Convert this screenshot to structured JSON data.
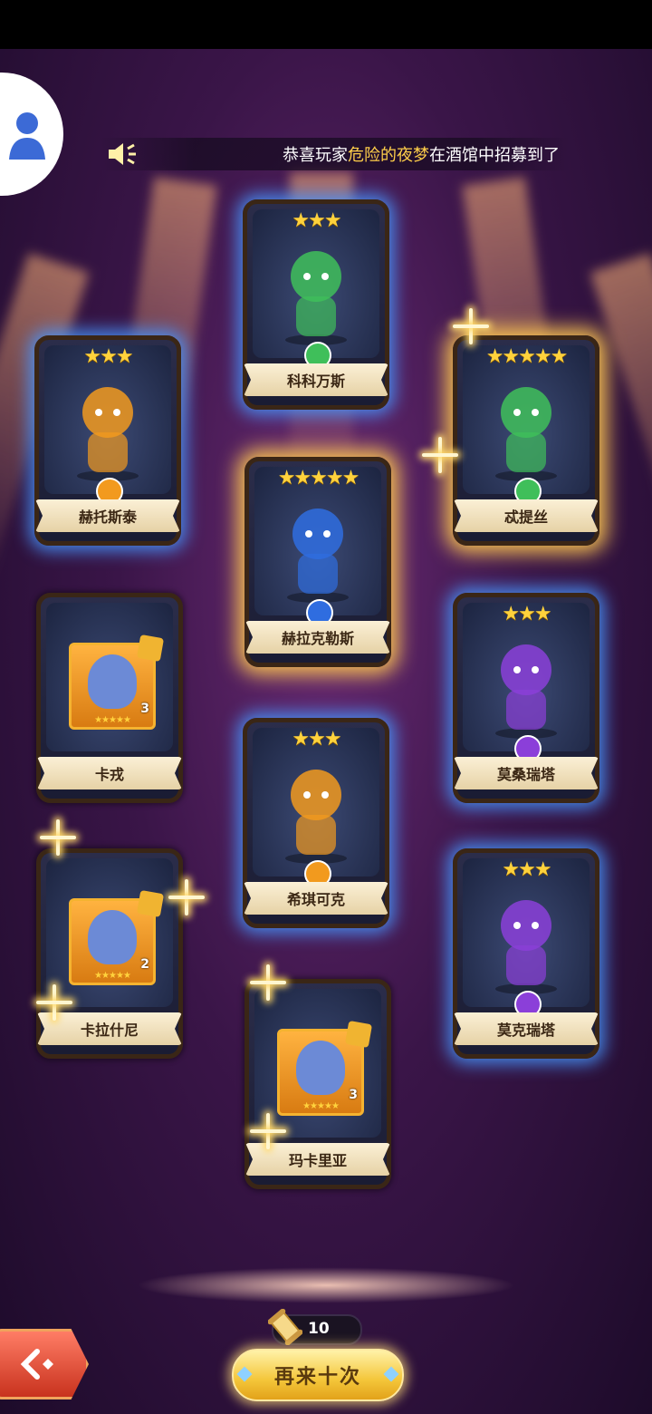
{
  "marquee": {
    "prefix": "恭喜玩家",
    "player": "危险的夜梦",
    "suffix": "在酒馆中招募到了"
  },
  "cards": [
    {
      "name": "科科万斯",
      "stars": "★★★",
      "glow": "blue",
      "kind": "hero",
      "element_color": "#3fbf5a"
    },
    {
      "name": "赫托斯泰",
      "stars": "★★★",
      "glow": "blue",
      "kind": "hero",
      "element_color": "#f29a1e"
    },
    {
      "name": "忒提丝",
      "stars": "★★★★★",
      "glow": "gold",
      "kind": "hero",
      "element_color": "#3fbf5a"
    },
    {
      "name": "赫拉克勒斯",
      "stars": "★★★★★",
      "glow": "gold",
      "kind": "hero",
      "element_color": "#2f6de0"
    },
    {
      "name": "卡戎",
      "glow": "none",
      "kind": "fragment",
      "count": "3"
    },
    {
      "name": "莫桑瑞塔",
      "stars": "★★★",
      "glow": "blue",
      "kind": "hero",
      "element_color": "#8b3fd9"
    },
    {
      "name": "希琪可克",
      "stars": "★★★",
      "glow": "blue",
      "kind": "hero",
      "element_color": "#f29a1e"
    },
    {
      "name": "卡拉什尼",
      "glow": "none",
      "kind": "fragment",
      "count": "2"
    },
    {
      "name": "莫克瑞塔",
      "stars": "★★★",
      "glow": "blue",
      "kind": "hero",
      "element_color": "#8b3fd9"
    },
    {
      "name": "玛卡里亚",
      "glow": "none",
      "kind": "fragment",
      "count": "3"
    }
  ],
  "fragment_stars": "★★★★★",
  "scroll_count": "10",
  "again_button": "再来十次",
  "icons": {
    "avatar": "user-avatar-icon",
    "speaker": "speaker-icon",
    "scroll": "summon-scroll-icon",
    "back": "back-arrow-icon"
  }
}
